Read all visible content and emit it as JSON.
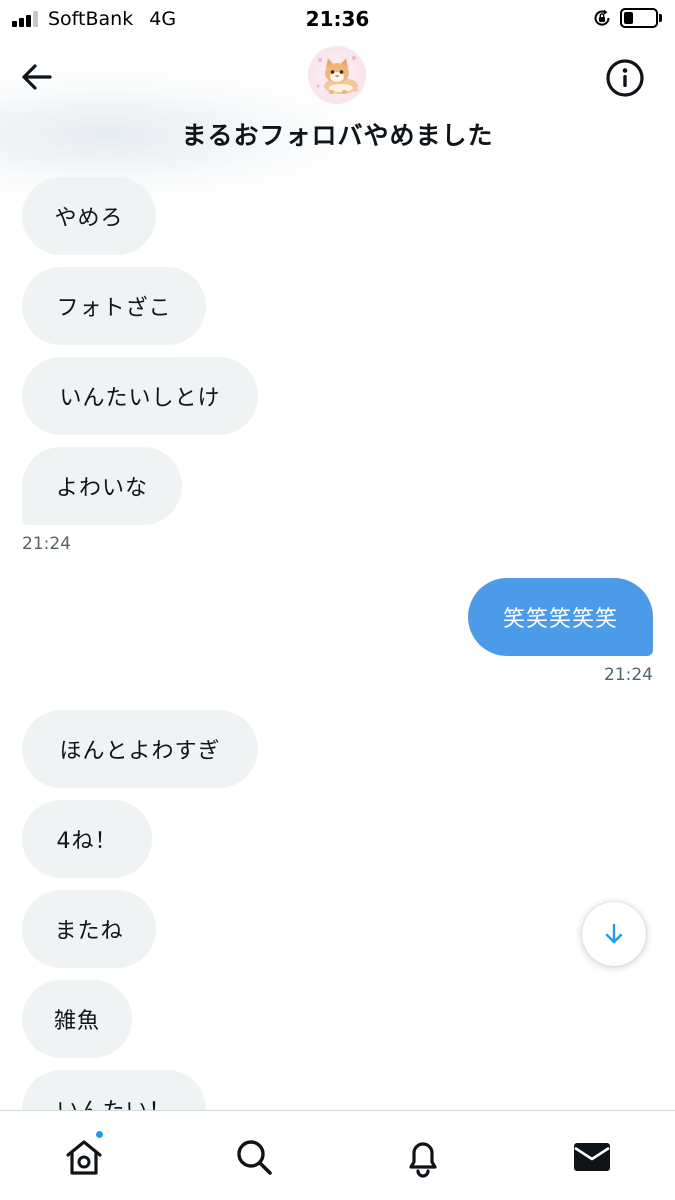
{
  "status_bar": {
    "carrier": "SoftBank",
    "network": "4G",
    "time": "21:36",
    "battery_level": 0.3
  },
  "header": {
    "title": "まるおフォロバやめました",
    "back_icon": "arrow-left-icon",
    "info_icon": "info-icon",
    "avatar": "cat-avatar"
  },
  "messages": [
    {
      "direction": "received",
      "text": "やめろ"
    },
    {
      "direction": "received",
      "text": "フォトざこ"
    },
    {
      "direction": "received",
      "text": "いんたいしとけ"
    },
    {
      "direction": "received",
      "text": "よわいな",
      "time": "21:24"
    },
    {
      "direction": "sent",
      "text": "笑笑笑笑笑",
      "time": "21:24"
    },
    {
      "direction": "received",
      "text": "ほんとよわすぎ"
    },
    {
      "direction": "received",
      "text": "4ね！"
    },
    {
      "direction": "received",
      "text": "またね"
    },
    {
      "direction": "received",
      "text": "雑魚"
    },
    {
      "direction": "received",
      "text": "いんたい！"
    }
  ],
  "scroll_button_icon": "arrow-down-icon",
  "tab_bar": {
    "items": [
      "home-icon",
      "search-icon",
      "bell-icon",
      "mail-icon"
    ],
    "active": "mail-icon",
    "home_has_notification": true
  },
  "colors": {
    "sent_bubble": "#4c9be8",
    "received_bubble": "#eff3f4",
    "accent": "#1d9bf0",
    "timestamp": "#536471"
  }
}
